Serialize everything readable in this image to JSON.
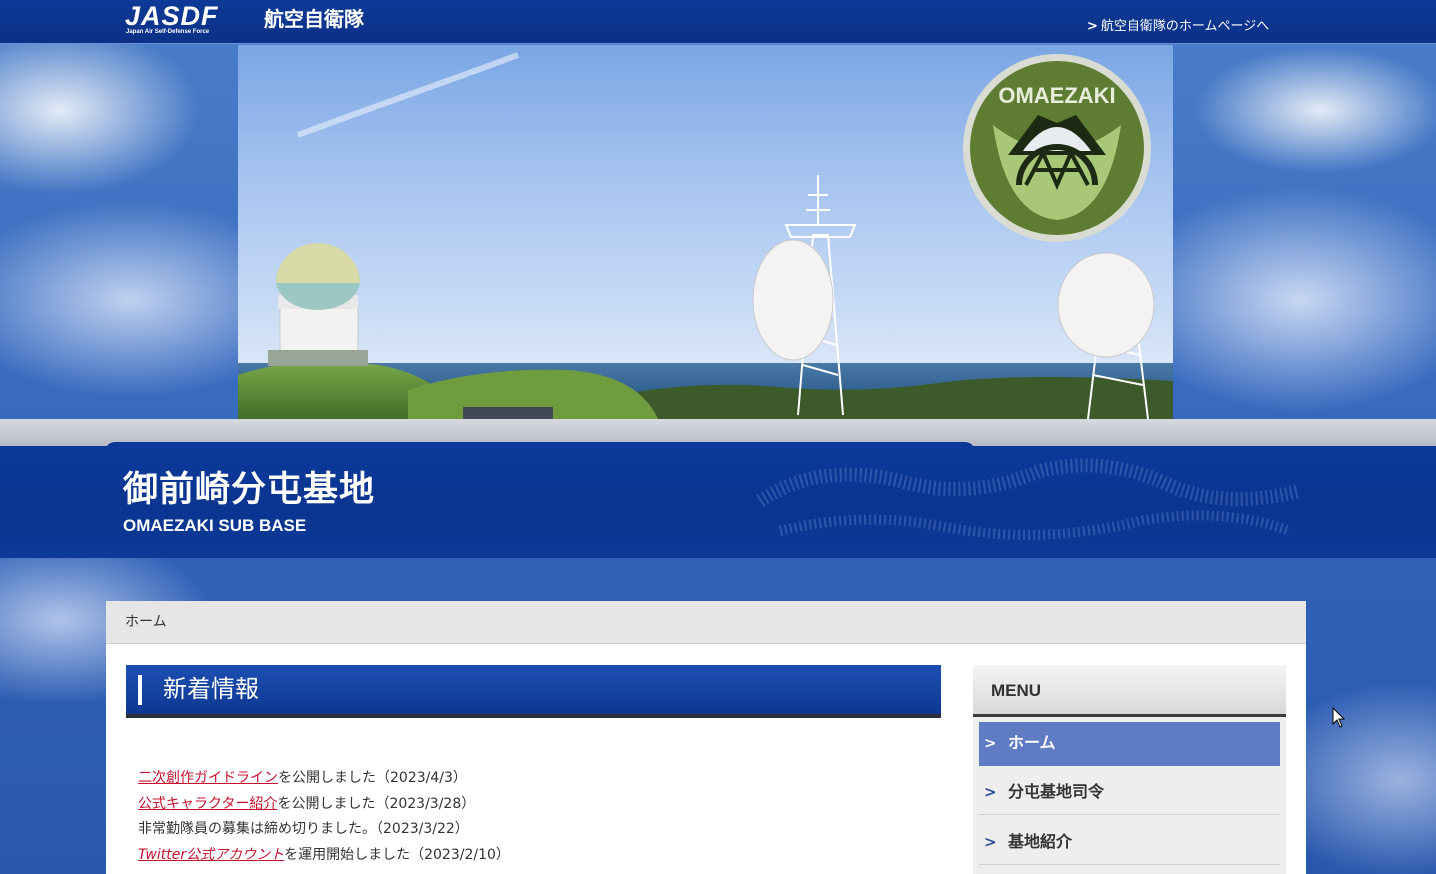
{
  "header": {
    "logo_text": "JASDF",
    "logo_subtext": "Japan Air Self-Defense Force",
    "logo_kanji": "航空自衛隊",
    "home_link_arrow": ">",
    "home_link_label": "航空自衛隊のホームページへ"
  },
  "hero": {
    "emblem_text": "OMAEZAKI"
  },
  "site": {
    "title": "御前崎分屯基地",
    "subtitle": "OMAEZAKI SUB BASE"
  },
  "breadcrumb": {
    "current": "ホーム"
  },
  "news": {
    "heading": "新着情報",
    "items": [
      {
        "link": "二次創作ガイドライン",
        "text": "を公開しました（2023/4/3）"
      },
      {
        "link": "公式キャラクター紹介",
        "text": "を公開しました（2023/3/28）"
      },
      {
        "link": "",
        "text": "非常勤隊員の募集は締め切りました。（2023/3/22）"
      },
      {
        "link": "Twitter公式アカウント",
        "text": "を運用開始しました（2023/2/10）"
      }
    ]
  },
  "menu": {
    "heading": "MENU",
    "chevron": ">",
    "items": [
      {
        "label": "ホーム",
        "active": true
      },
      {
        "label": "分屯基地司令",
        "active": false
      },
      {
        "label": "基地紹介",
        "active": false
      }
    ]
  },
  "colors": {
    "header_bg": "#0a3087",
    "title_band_bg": "#0b3a9c",
    "link_red": "#c4122f",
    "menu_active": "#5f7bc4",
    "emblem_green": "#6b8b3a"
  }
}
